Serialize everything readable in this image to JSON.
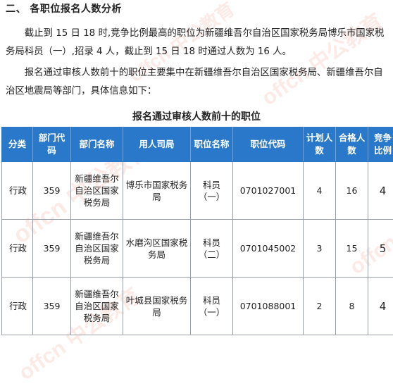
{
  "section_heading": "二、 各职位报名人数分析",
  "paragraphs": [
    "截止到 15 日 18 时,竞争比例最高的职位为新疆维吾尔自治区国家税务局博乐市国家税务局科员（一）,招录 4 人，截止到 15 日 18 时通过人数为 16 人。",
    "报名通过审核人数前十的职位主要集中在新疆维吾尔自治区国家税务局、新疆维吾尔自治区地震局等部门，具体信息如下："
  ],
  "table_title": "报名通过审核人数前十的职位",
  "table": {
    "headers": {
      "category": "分类",
      "dept_code": "部门代码",
      "dept_name": "部门名称",
      "hiring_unit": "用人司局",
      "position_name": "职位名称",
      "position_code": "职位代码",
      "planned": "计划人数",
      "qualified": "合格人数",
      "ratio": "竞争比例"
    },
    "rows": [
      {
        "category": "行政",
        "dept_code": "359",
        "dept_name": "新疆维吾尔自治区国家税务局",
        "hiring_unit": "博乐市国家税务局",
        "position_name": "科员（一）",
        "position_code": "0701027001",
        "planned": "4",
        "qualified": "16",
        "ratio": "4"
      },
      {
        "category": "行政",
        "dept_code": "359",
        "dept_name": "新疆维吾尔自治区国家税务局",
        "hiring_unit": "水磨沟区国家税务局",
        "position_name": "科员（二）",
        "position_code": "0701045002",
        "planned": "3",
        "qualified": "15",
        "ratio": "5"
      },
      {
        "category": "行政",
        "dept_code": "359",
        "dept_name": "新疆维吾尔自治区国家税务局",
        "hiring_unit": "叶城县国家税务局",
        "position_name": "科员（一）",
        "position_code": "0701088001",
        "planned": "2",
        "qualified": "8",
        "ratio": "4"
      }
    ]
  },
  "watermark_text": "offcn 中公教育",
  "colors": {
    "header_bg": "#2a78c9",
    "header_text": "#ffffff",
    "watermark": "#e65a3c"
  }
}
